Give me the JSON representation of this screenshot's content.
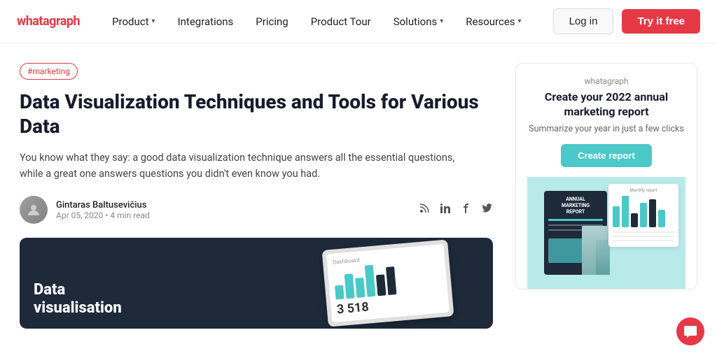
{
  "nav": {
    "logo": "whatagraph",
    "links": [
      {
        "label": "Product",
        "hasChevron": true
      },
      {
        "label": "Integrations",
        "hasChevron": false
      },
      {
        "label": "Pricing",
        "hasChevron": false
      },
      {
        "label": "Product Tour",
        "hasChevron": false
      },
      {
        "label": "Solutions",
        "hasChevron": true
      },
      {
        "label": "Resources",
        "hasChevron": true
      }
    ],
    "login_label": "Log in",
    "try_label": "Try it free"
  },
  "article": {
    "tag": "#marketing",
    "title": "Data Visualization Techniques and Tools for Various Data",
    "excerpt": "You know what they say: a good data visualization technique answers all the essential questions, while a great one answers questions you didn't even know you had.",
    "author_name": "Gintaras Baltusevičius",
    "author_date": "Apr 05, 2020 • 4 min read",
    "image_text_line1": "Data",
    "image_text_line2": "visualisation",
    "number_label": "3 518"
  },
  "promo": {
    "brand": "whatagraph",
    "title": "Create your 2022 annual marketing report",
    "subtitle": "Summarize your year in just a few clicks",
    "cta_label": "Create report",
    "report_title_line1": "ANNUAL",
    "report_title_line2": "MARKETING",
    "report_title_line3": "REPORT"
  },
  "colors": {
    "accent_red": "#e63946",
    "accent_teal": "#4bc8c8",
    "dark_navy": "#1e2a3a"
  }
}
